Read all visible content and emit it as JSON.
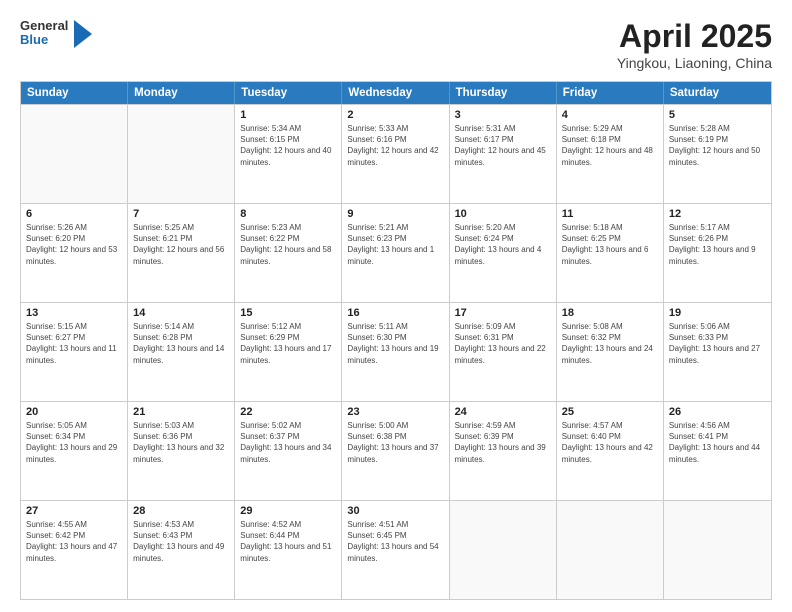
{
  "header": {
    "logo_general": "General",
    "logo_blue": "Blue",
    "title": "April 2025",
    "location": "Yingkou, Liaoning, China"
  },
  "days_of_week": [
    "Sunday",
    "Monday",
    "Tuesday",
    "Wednesday",
    "Thursday",
    "Friday",
    "Saturday"
  ],
  "weeks": [
    [
      {
        "day": "",
        "sunrise": "",
        "sunset": "",
        "daylight": "",
        "empty": true
      },
      {
        "day": "",
        "sunrise": "",
        "sunset": "",
        "daylight": "",
        "empty": true
      },
      {
        "day": "1",
        "sunrise": "Sunrise: 5:34 AM",
        "sunset": "Sunset: 6:15 PM",
        "daylight": "Daylight: 12 hours and 40 minutes.",
        "empty": false
      },
      {
        "day": "2",
        "sunrise": "Sunrise: 5:33 AM",
        "sunset": "Sunset: 6:16 PM",
        "daylight": "Daylight: 12 hours and 42 minutes.",
        "empty": false
      },
      {
        "day": "3",
        "sunrise": "Sunrise: 5:31 AM",
        "sunset": "Sunset: 6:17 PM",
        "daylight": "Daylight: 12 hours and 45 minutes.",
        "empty": false
      },
      {
        "day": "4",
        "sunrise": "Sunrise: 5:29 AM",
        "sunset": "Sunset: 6:18 PM",
        "daylight": "Daylight: 12 hours and 48 minutes.",
        "empty": false
      },
      {
        "day": "5",
        "sunrise": "Sunrise: 5:28 AM",
        "sunset": "Sunset: 6:19 PM",
        "daylight": "Daylight: 12 hours and 50 minutes.",
        "empty": false
      }
    ],
    [
      {
        "day": "6",
        "sunrise": "Sunrise: 5:26 AM",
        "sunset": "Sunset: 6:20 PM",
        "daylight": "Daylight: 12 hours and 53 minutes.",
        "empty": false
      },
      {
        "day": "7",
        "sunrise": "Sunrise: 5:25 AM",
        "sunset": "Sunset: 6:21 PM",
        "daylight": "Daylight: 12 hours and 56 minutes.",
        "empty": false
      },
      {
        "day": "8",
        "sunrise": "Sunrise: 5:23 AM",
        "sunset": "Sunset: 6:22 PM",
        "daylight": "Daylight: 12 hours and 58 minutes.",
        "empty": false
      },
      {
        "day": "9",
        "sunrise": "Sunrise: 5:21 AM",
        "sunset": "Sunset: 6:23 PM",
        "daylight": "Daylight: 13 hours and 1 minute.",
        "empty": false
      },
      {
        "day": "10",
        "sunrise": "Sunrise: 5:20 AM",
        "sunset": "Sunset: 6:24 PM",
        "daylight": "Daylight: 13 hours and 4 minutes.",
        "empty": false
      },
      {
        "day": "11",
        "sunrise": "Sunrise: 5:18 AM",
        "sunset": "Sunset: 6:25 PM",
        "daylight": "Daylight: 13 hours and 6 minutes.",
        "empty": false
      },
      {
        "day": "12",
        "sunrise": "Sunrise: 5:17 AM",
        "sunset": "Sunset: 6:26 PM",
        "daylight": "Daylight: 13 hours and 9 minutes.",
        "empty": false
      }
    ],
    [
      {
        "day": "13",
        "sunrise": "Sunrise: 5:15 AM",
        "sunset": "Sunset: 6:27 PM",
        "daylight": "Daylight: 13 hours and 11 minutes.",
        "empty": false
      },
      {
        "day": "14",
        "sunrise": "Sunrise: 5:14 AM",
        "sunset": "Sunset: 6:28 PM",
        "daylight": "Daylight: 13 hours and 14 minutes.",
        "empty": false
      },
      {
        "day": "15",
        "sunrise": "Sunrise: 5:12 AM",
        "sunset": "Sunset: 6:29 PM",
        "daylight": "Daylight: 13 hours and 17 minutes.",
        "empty": false
      },
      {
        "day": "16",
        "sunrise": "Sunrise: 5:11 AM",
        "sunset": "Sunset: 6:30 PM",
        "daylight": "Daylight: 13 hours and 19 minutes.",
        "empty": false
      },
      {
        "day": "17",
        "sunrise": "Sunrise: 5:09 AM",
        "sunset": "Sunset: 6:31 PM",
        "daylight": "Daylight: 13 hours and 22 minutes.",
        "empty": false
      },
      {
        "day": "18",
        "sunrise": "Sunrise: 5:08 AM",
        "sunset": "Sunset: 6:32 PM",
        "daylight": "Daylight: 13 hours and 24 minutes.",
        "empty": false
      },
      {
        "day": "19",
        "sunrise": "Sunrise: 5:06 AM",
        "sunset": "Sunset: 6:33 PM",
        "daylight": "Daylight: 13 hours and 27 minutes.",
        "empty": false
      }
    ],
    [
      {
        "day": "20",
        "sunrise": "Sunrise: 5:05 AM",
        "sunset": "Sunset: 6:34 PM",
        "daylight": "Daylight: 13 hours and 29 minutes.",
        "empty": false
      },
      {
        "day": "21",
        "sunrise": "Sunrise: 5:03 AM",
        "sunset": "Sunset: 6:36 PM",
        "daylight": "Daylight: 13 hours and 32 minutes.",
        "empty": false
      },
      {
        "day": "22",
        "sunrise": "Sunrise: 5:02 AM",
        "sunset": "Sunset: 6:37 PM",
        "daylight": "Daylight: 13 hours and 34 minutes.",
        "empty": false
      },
      {
        "day": "23",
        "sunrise": "Sunrise: 5:00 AM",
        "sunset": "Sunset: 6:38 PM",
        "daylight": "Daylight: 13 hours and 37 minutes.",
        "empty": false
      },
      {
        "day": "24",
        "sunrise": "Sunrise: 4:59 AM",
        "sunset": "Sunset: 6:39 PM",
        "daylight": "Daylight: 13 hours and 39 minutes.",
        "empty": false
      },
      {
        "day": "25",
        "sunrise": "Sunrise: 4:57 AM",
        "sunset": "Sunset: 6:40 PM",
        "daylight": "Daylight: 13 hours and 42 minutes.",
        "empty": false
      },
      {
        "day": "26",
        "sunrise": "Sunrise: 4:56 AM",
        "sunset": "Sunset: 6:41 PM",
        "daylight": "Daylight: 13 hours and 44 minutes.",
        "empty": false
      }
    ],
    [
      {
        "day": "27",
        "sunrise": "Sunrise: 4:55 AM",
        "sunset": "Sunset: 6:42 PM",
        "daylight": "Daylight: 13 hours and 47 minutes.",
        "empty": false
      },
      {
        "day": "28",
        "sunrise": "Sunrise: 4:53 AM",
        "sunset": "Sunset: 6:43 PM",
        "daylight": "Daylight: 13 hours and 49 minutes.",
        "empty": false
      },
      {
        "day": "29",
        "sunrise": "Sunrise: 4:52 AM",
        "sunset": "Sunset: 6:44 PM",
        "daylight": "Daylight: 13 hours and 51 minutes.",
        "empty": false
      },
      {
        "day": "30",
        "sunrise": "Sunrise: 4:51 AM",
        "sunset": "Sunset: 6:45 PM",
        "daylight": "Daylight: 13 hours and 54 minutes.",
        "empty": false
      },
      {
        "day": "",
        "sunrise": "",
        "sunset": "",
        "daylight": "",
        "empty": true
      },
      {
        "day": "",
        "sunrise": "",
        "sunset": "",
        "daylight": "",
        "empty": true
      },
      {
        "day": "",
        "sunrise": "",
        "sunset": "",
        "daylight": "",
        "empty": true
      }
    ]
  ]
}
